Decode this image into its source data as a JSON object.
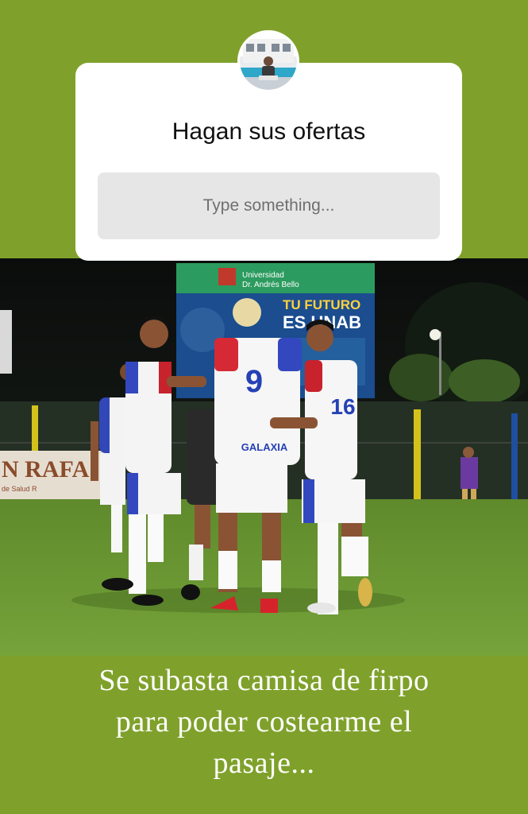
{
  "story": {
    "background_color": "#7fa12b",
    "question_sticker": {
      "question": "Hagan sus ofertas",
      "answer_placeholder": "Type something...",
      "avatar_icon": "profile-avatar"
    },
    "photo": {
      "icon": "soccer-team-photo",
      "billboard": {
        "line1": "Universidad",
        "line2": "Dr. Andrés Bello",
        "line3": "TU FUTURO",
        "line4": "ES UNAB"
      },
      "fence_banner": "N RAFA",
      "fence_banner_small": "de Salud  R",
      "jersey_numbers": [
        "9",
        "16"
      ],
      "sponsor": "GALAXIA"
    },
    "caption": {
      "line1": "Se subasta camisa de firpo",
      "line2": "para poder costearme el",
      "line3": "pasaje..."
    }
  }
}
